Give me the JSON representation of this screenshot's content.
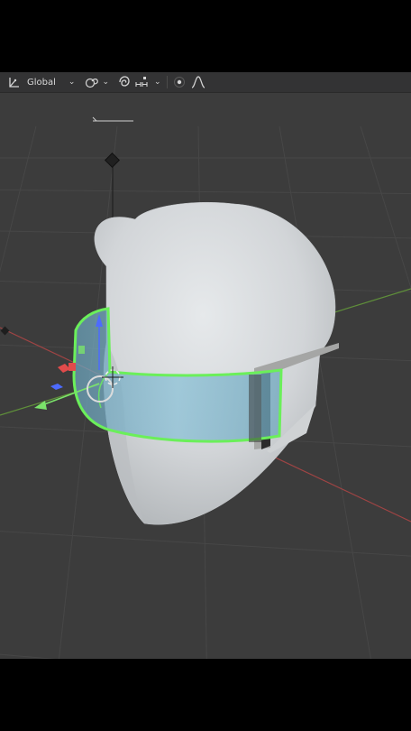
{
  "toolbar": {
    "transform_orientation": {
      "label": "Global",
      "icon": "transform-orientation-icon"
    },
    "pivot": {
      "icon": "pivot-point-icon"
    },
    "snap": {
      "icon": "snap-magnet-icon",
      "target_icon": "snap-increment-icon"
    },
    "proportional_editing": {
      "icon": "proportional-editing-icon",
      "falloff_icon": "falloff-curve-icon"
    }
  },
  "scene": {
    "active_object": "visor",
    "colors": {
      "background": "#3c3c3c",
      "grid": "#4a4a4a",
      "x_axis": "#a04444",
      "y_axis": "#6a9e3c",
      "selection_outline": "#6bef5a",
      "visor": "#7eb2c8",
      "head": "#d6d9dc",
      "gizmo_z": "#4d6bff",
      "gizmo_x": "#e24b4b",
      "gizmo_y": "#7be36a"
    }
  }
}
